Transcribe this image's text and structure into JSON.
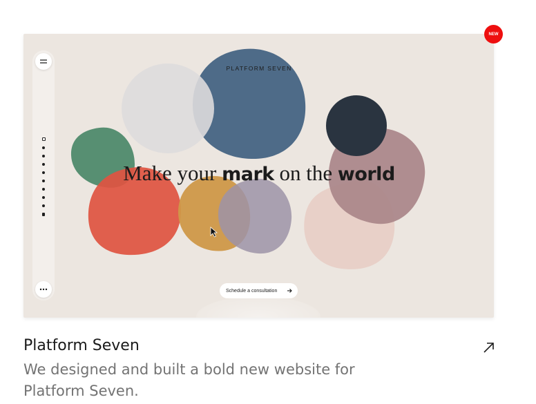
{
  "badge": {
    "label": "NEW"
  },
  "preview": {
    "brand": "PLATFORM SEVEN",
    "headline": {
      "part1": "Make your ",
      "bold1": "mark",
      "part2": " on the ",
      "bold2": "world"
    },
    "cta": {
      "label": "Schedule a consultation",
      "icon": "arrow-right-icon"
    },
    "sidebar": {
      "menu_icon": "menu-icon",
      "more_icon": "more-icon",
      "nav_dot_count": 10
    },
    "colors": {
      "background": "#ece6e0",
      "green": "#4f8a6c",
      "red": "#df5442",
      "ochre": "#cf9848",
      "lavender": "#9d93a7",
      "blue": "#4e6b88",
      "grey": "#dedcdd",
      "navy": "#2a3440",
      "mauve": "#a98589",
      "pink": "#e8cbc3"
    }
  },
  "project": {
    "title": "Platform Seven",
    "description": "We designed and built a bold new website for Platform Seven.",
    "link_icon": "external-link-arrow-icon"
  },
  "accent": "#ee0f0f"
}
